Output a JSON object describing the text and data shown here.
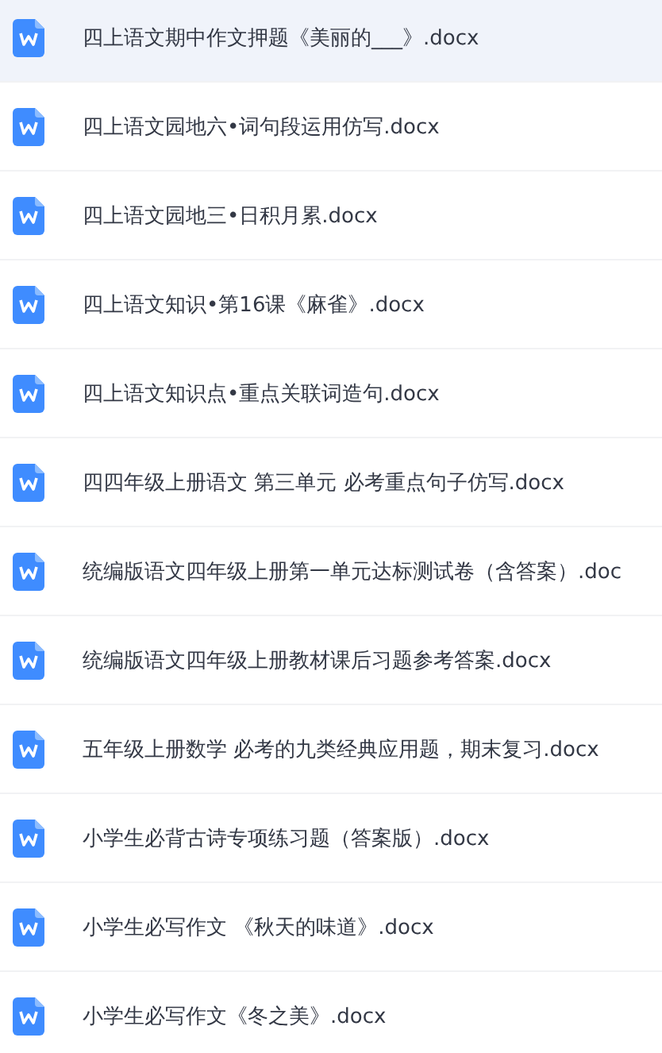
{
  "files": [
    {
      "name": "四上语文期中作文押题《美丽的___》.docx",
      "selected": true
    },
    {
      "name": "四上语文园地六•词句段运用仿写.docx",
      "selected": false
    },
    {
      "name": "四上语文园地三•日积月累.docx",
      "selected": false
    },
    {
      "name": "四上语文知识•第16课《麻雀》.docx",
      "selected": false
    },
    {
      "name": "四上语文知识点•重点关联词造句.docx",
      "selected": false
    },
    {
      "name": "四四年级上册语文 第三单元 必考重点句子仿写.docx",
      "selected": false
    },
    {
      "name": "统编版语文四年级上册第一单元达标测试卷（含答案）.doc",
      "selected": false
    },
    {
      "name": "统编版语文四年级上册教材课后习题参考答案.docx",
      "selected": false
    },
    {
      "name": "五年级上册数学 必考的九类经典应用题，期末复习.docx",
      "selected": false
    },
    {
      "name": "小学生必背古诗专项练习题（答案版）.docx",
      "selected": false
    },
    {
      "name": "小学生必写作文 《秋天的味道》.docx",
      "selected": false
    },
    {
      "name": "小学生必写作文《冬之美》.docx",
      "selected": false
    }
  ]
}
